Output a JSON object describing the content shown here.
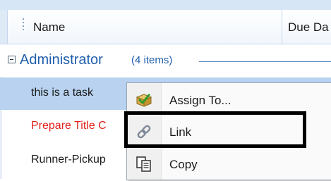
{
  "columns": {
    "name_label": "Name",
    "due_label": "Due Da"
  },
  "group": {
    "title": "Administrator",
    "count": "(4 items)"
  },
  "tasks": [
    {
      "name": "this is a task",
      "selected": true,
      "color": "#1b1b1b"
    },
    {
      "name": "Prepare Title C",
      "selected": false,
      "color": "#e0201c"
    },
    {
      "name": "Runner-Pickup",
      "selected": false,
      "color": "#1b1b1b"
    }
  ],
  "context_menu": {
    "items": [
      {
        "label": "Assign To...",
        "icon": "assign-icon"
      },
      {
        "label": "Link",
        "icon": "link-icon"
      },
      {
        "label": "Copy",
        "icon": "copy-icon"
      }
    ]
  },
  "colors": {
    "selection": "#b8d2f0",
    "group_text": "#1f5fad",
    "overdue_text": "#e0201c",
    "highlight_outline": "#000000"
  }
}
